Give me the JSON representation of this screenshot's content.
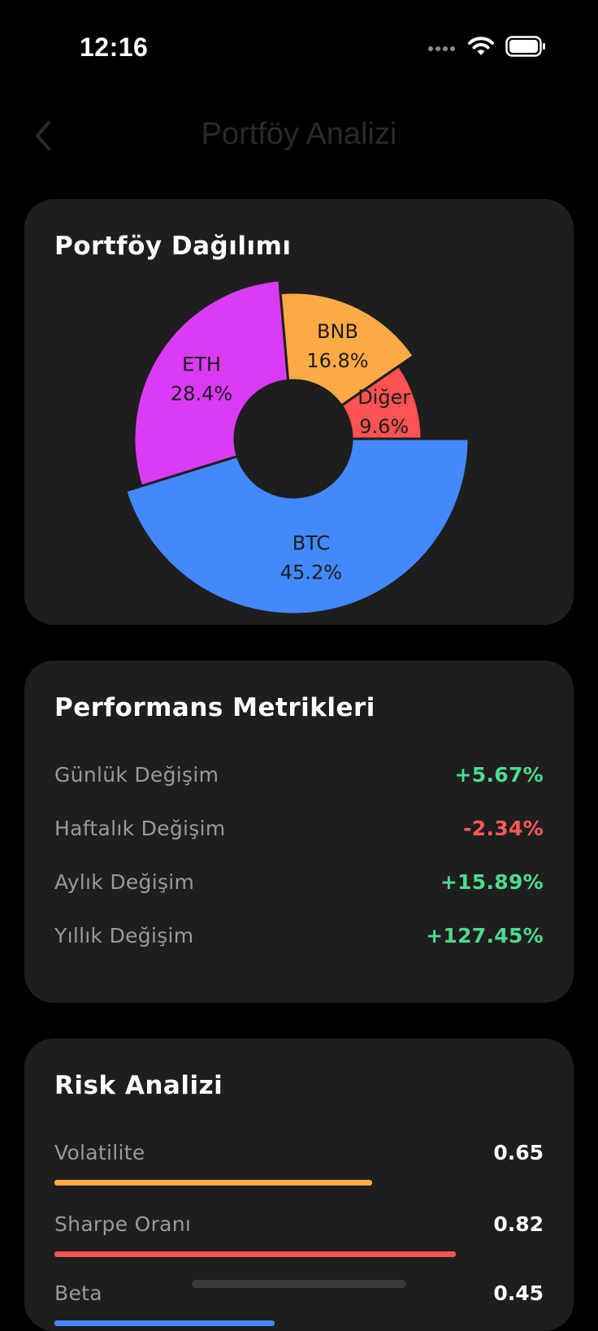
{
  "status_bar": {
    "time": "12:16",
    "icons": [
      "signal-dots-icon",
      "wifi-icon",
      "battery-icon"
    ]
  },
  "nav": {
    "title": "Portföy Analizi",
    "back_icon": "chevron-left-icon"
  },
  "portfolio_card": {
    "title": "Portföy Dağılımı"
  },
  "chart_data": {
    "type": "pie",
    "donut": true,
    "slices": [
      {
        "name": "BTC",
        "label": "45.2%",
        "value": 45.2,
        "color": "#4389fc"
      },
      {
        "name": "ETH",
        "label": "28.4%",
        "value": 28.4,
        "color": "#db3bf5"
      },
      {
        "name": "BNB",
        "label": "16.8%",
        "value": 16.8,
        "color": "#ffab45"
      },
      {
        "name": "Diğer",
        "label": "9.6%",
        "value": 9.6,
        "color": "#ff5252"
      }
    ]
  },
  "performance_card": {
    "title": "Performans Metrikleri",
    "metrics": [
      {
        "label": "Günlük Değişim",
        "value": "+5.67%",
        "color": "#4ddb8f"
      },
      {
        "label": "Haftalık Değişim",
        "value": "-2.34%",
        "color": "#ff5a5a"
      },
      {
        "label": "Aylık Değişim",
        "value": "+15.89%",
        "color": "#4ddb8f"
      },
      {
        "label": "Yıllık Değişim",
        "value": "+127.45%",
        "color": "#4ddb8f"
      }
    ]
  },
  "risk_card": {
    "title": "Risk Analizi",
    "items": [
      {
        "label": "Volatilite",
        "value": "0.65",
        "fill": 0.65,
        "color": "#ffab45"
      },
      {
        "label": "Sharpe Oranı",
        "value": "0.82",
        "fill": 0.82,
        "color": "#ff5252"
      },
      {
        "label": "Beta",
        "value": "0.45",
        "fill": 0.45,
        "color": "#4389fc"
      }
    ]
  }
}
